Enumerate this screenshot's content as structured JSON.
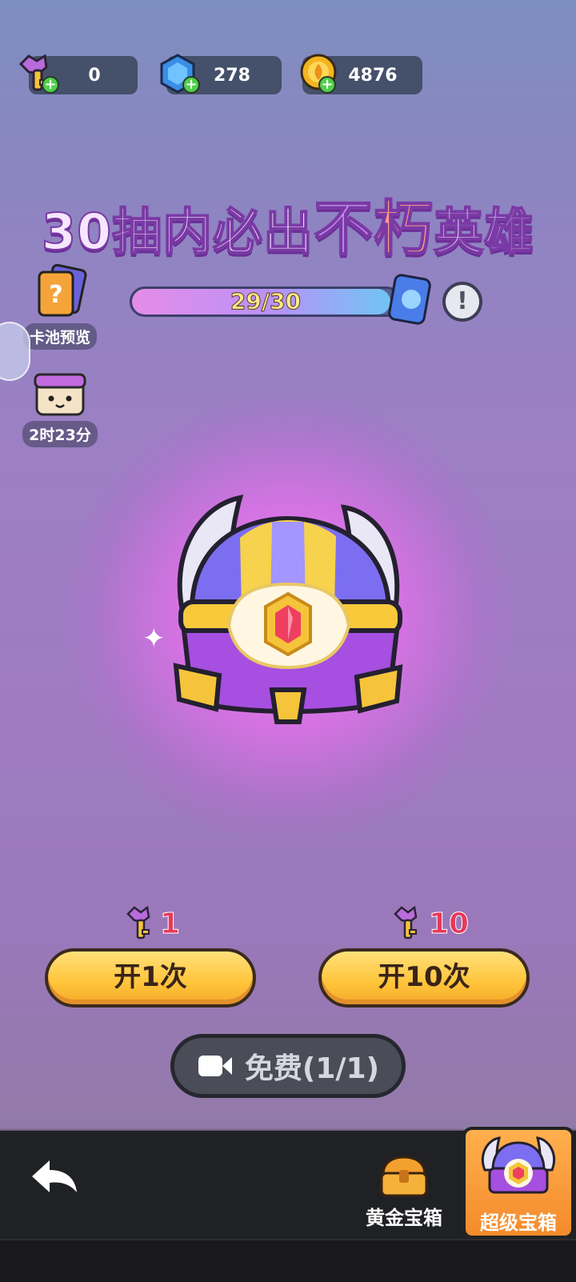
{
  "resources": {
    "keys": "0",
    "gems": "278",
    "coins": "4876"
  },
  "headline": {
    "part1": "30抽内必出",
    "part2": "不",
    "part3": "朽",
    "part4": "英雄"
  },
  "side": {
    "pool_preview": "卡池预览",
    "timer": "2时23分"
  },
  "progress": {
    "text": "29/30",
    "value": 29,
    "max": 30
  },
  "open_once": {
    "cost": "1",
    "label": "开1次"
  },
  "open_ten": {
    "cost": "10",
    "label": "开10次"
  },
  "free": {
    "label": "免费(1/1)"
  },
  "tabs": {
    "gold_chest": "黄金宝箱",
    "super_chest": "超级宝箱"
  },
  "icons": [
    "key-icon",
    "gem-icon",
    "coin-icon",
    "card-icon",
    "info-icon",
    "video-icon",
    "back-arrow-icon",
    "chest-icon"
  ],
  "colors": {
    "button_yellow": "#ffc43a",
    "cost_red": "#e8385a",
    "tab_active": "#f48a2c"
  }
}
